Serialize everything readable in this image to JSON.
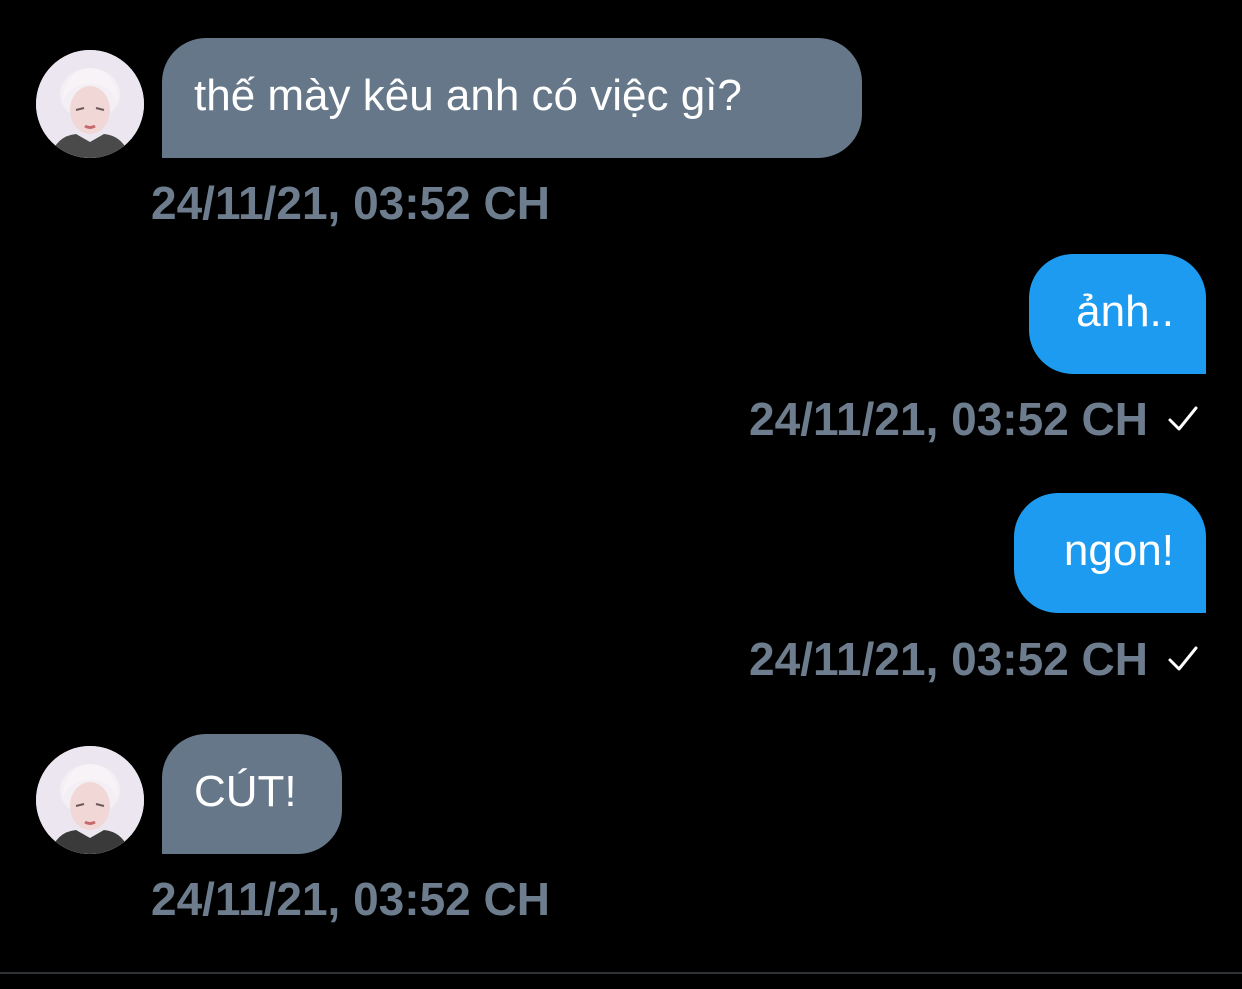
{
  "colors": {
    "background": "#000000",
    "received_bubble": "#66778a",
    "sent_bubble": "#1d9bf0",
    "timestamp": "#6e7d8e",
    "text": "#ffffff"
  },
  "messages": [
    {
      "direction": "received",
      "avatar_icon": "user-avatar",
      "text": "thế mày kêu anh có việc gì?",
      "timestamp": "24/11/21, 03:52 CH"
    },
    {
      "direction": "sent",
      "text": "ảnh..",
      "timestamp": "24/11/21, 03:52 CH",
      "status_icon": "check-icon"
    },
    {
      "direction": "sent",
      "text": "ngon!",
      "timestamp": "24/11/21, 03:52 CH",
      "status_icon": "check-icon"
    },
    {
      "direction": "received",
      "avatar_icon": "user-avatar",
      "text": "CÚT!",
      "timestamp": "24/11/21, 03:52 CH"
    }
  ]
}
